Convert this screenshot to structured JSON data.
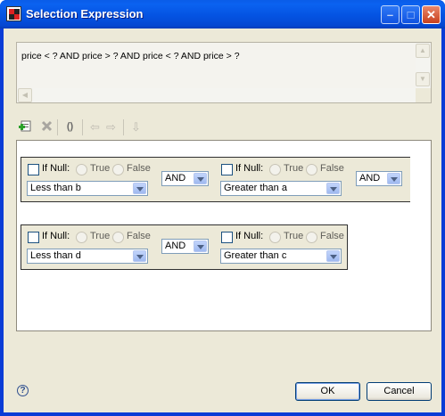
{
  "window": {
    "title": "Selection Expression",
    "controls": {
      "minimize": "–",
      "maximize": "□",
      "close": "✕"
    }
  },
  "expression": {
    "text": "price < ? AND price > ? AND price < ? AND price > ?"
  },
  "toolbar": {
    "icons": [
      "add-condition-icon",
      "delete-icon",
      "parentheses-icon",
      "move-left-icon",
      "move-right-icon",
      "move-down-icon"
    ],
    "parentheses_label": "()"
  },
  "rows": [
    {
      "conditions": [
        {
          "if_null_label": "If Null:",
          "true_label": "True",
          "false_label": "False",
          "operator": "Less than b"
        },
        {
          "if_null_label": "If Null:",
          "true_label": "True",
          "false_label": "False",
          "operator": "Greater than a"
        }
      ],
      "connector": "AND",
      "trailing_connector": "AND"
    },
    {
      "conditions": [
        {
          "if_null_label": "If Null:",
          "true_label": "True",
          "false_label": "False",
          "operator": "Less than d"
        },
        {
          "if_null_label": "If Null:",
          "true_label": "True",
          "false_label": "False",
          "operator": "Greater than c"
        }
      ],
      "connector": "AND"
    }
  ],
  "footer": {
    "help_label": "?",
    "ok_label": "OK",
    "cancel_label": "Cancel"
  },
  "colors": {
    "titlebar": "#0453e2",
    "dialog_bg": "#ece9d8",
    "combo_border": "#7f9db9"
  }
}
